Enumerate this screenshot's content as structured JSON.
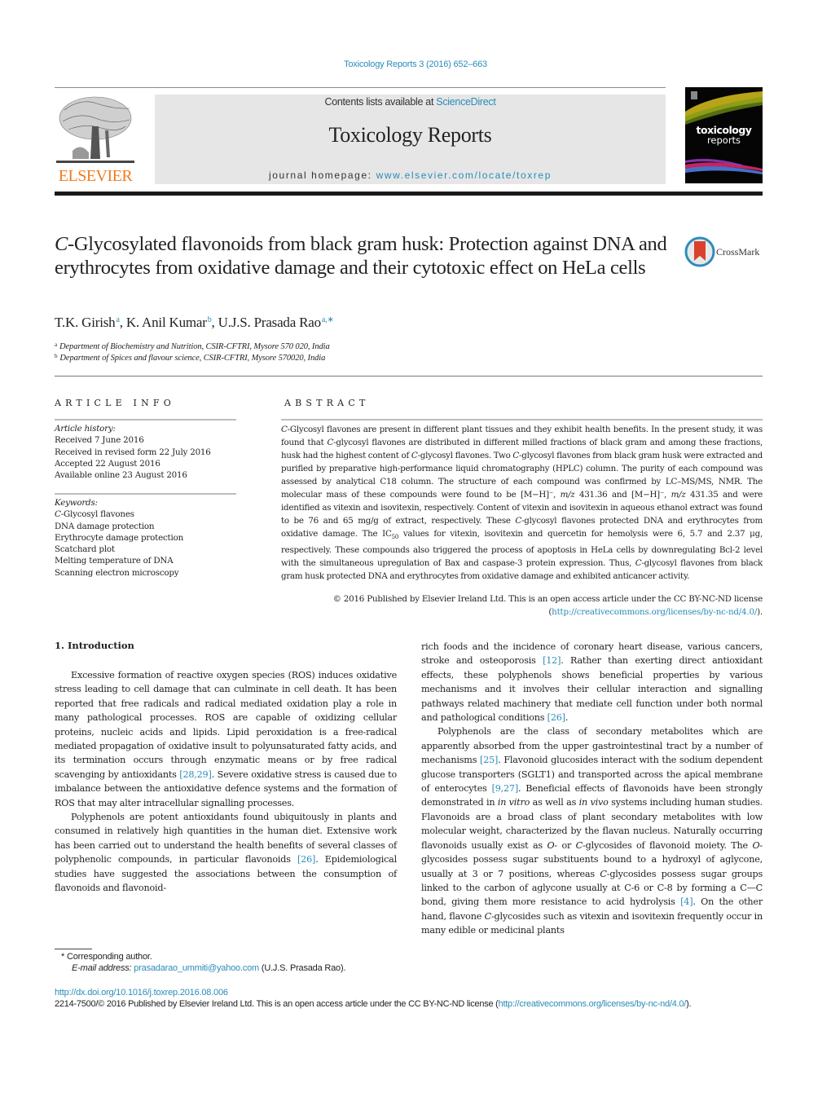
{
  "journal_ref": "Toxicology Reports 3 (2016) 652–663",
  "masthead": {
    "publisher_logo_text": "ELSEVIER",
    "contents_prefix": "Contents lists available at ",
    "contents_link": "ScienceDirect",
    "journal_title": "Toxicology Reports",
    "homepage_prefix": "journal homepage: ",
    "homepage_link": "www.elsevier.com/locate/toxrep",
    "cover_title": "toxicology",
    "cover_subtitle": "reports"
  },
  "colors": {
    "link": "#2a8cb8",
    "elsevier_orange": "#f07b1f",
    "masthead_bg": "#e6e6e6"
  },
  "article": {
    "title_italic_prefix": "C",
    "title_rest": "-Glycosylated flavonoids from black gram husk: Protection against DNA and erythrocytes from oxidative damage and their cytotoxic effect on HeLa cells",
    "crossmark_label": "CrossMark",
    "authors": [
      {
        "name": "T.K. Girish",
        "sup": "a"
      },
      {
        "name": "K. Anil Kumar",
        "sup": "b"
      },
      {
        "name": "U.J.S. Prasada Rao",
        "sup": "a,∗"
      }
    ],
    "affiliations": [
      {
        "mark": "a",
        "text": "Department of Biochemistry and Nutrition, CSIR-CFTRI, Mysore 570 020, India"
      },
      {
        "mark": "b",
        "text": "Department of Spices and flavour science, CSIR-CFTRI, Mysore 570020, India"
      }
    ]
  },
  "article_info": {
    "heading": "ARTICLE INFO",
    "history_label": "Article history:",
    "history": [
      "Received 7 June 2016",
      "Received in revised form 22 July 2016",
      "Accepted 22 August 2016",
      "Available online 23 August 2016"
    ],
    "keywords_label": "Keywords:",
    "keywords": [
      {
        "italic": "C",
        "rest": "-Glycosyl flavones"
      },
      {
        "italic": "",
        "rest": "DNA damage protection"
      },
      {
        "italic": "",
        "rest": "Erythrocyte damage protection"
      },
      {
        "italic": "",
        "rest": "Scatchard plot"
      },
      {
        "italic": "",
        "rest": "Melting temperature of DNA"
      },
      {
        "italic": "",
        "rest": "Scanning electron microscopy"
      }
    ]
  },
  "abstract": {
    "heading": "ABSTRACT",
    "s1_i": "C",
    "s1": "-Glycosyl flavones are present in different plant tissues and they exhibit health benefits. In the present study, it was found that ",
    "s2_i": "C",
    "s2": "-glycosyl flavones are distributed in different milled fractions of black gram and among these fractions, husk had the highest content of ",
    "s3_i": "C",
    "s3": "-glycosyl flavones. Two ",
    "s4_i": "C",
    "s4": "-glycosyl flavones from black gram husk were extracted and purified by preparative high-performance liquid chromatography (HPLC) column. The purity of each compound was assessed by analytical C18 column. The structure of each compound was confirmed by LC–MS/MS, NMR. The molecular mass of these compounds were found to be [M−H]⁻, ",
    "mz1_i": "m/z",
    "s5": " 431.36 and [M−H]⁻, ",
    "mz2_i": "m/z",
    "s6": " 431.35 and were identified as vitexin and isovitexin, respectively. Content of vitexin and isovitexin in aqueous ethanol extract was found to be 76 and 65 mg/g of extract, respectively. These ",
    "s7_i": "C",
    "s7": "-glycosyl flavones protected DNA and erythrocytes from oxidative damage. The IC",
    "ic_sub": "50",
    "s8": " values for vitexin, isovitexin and quercetin for hemolysis were 6, 5.7 and 2.37 μg, respectively. These compounds also triggered the process of apoptosis in HeLa cells by downregulating Bcl-2 level with the simultaneous upregulation of Bax and caspase-3 protein expression. Thus, ",
    "s9_i": "C",
    "s9": "-glycosyl flavones from black gram husk protected DNA and erythrocytes from oxidative damage and exhibited anticancer activity.",
    "copyright_prefix": "© 2016 Published by Elsevier Ireland Ltd. This is an open access article under the CC BY-NC-ND license (",
    "copyright_link": "http://creativecommons.org/licenses/by-nc-nd/4.0/",
    "copyright_suffix": ")."
  },
  "body": {
    "section_heading": "1.  Introduction",
    "left_p1_a": "Excessive formation of reactive oxygen species (ROS) induces oxidative stress leading to cell damage that can culminate in cell death. It has been reported that free radicals and radical mediated oxidation play a role in many pathological processes. ROS are capable of oxidizing cellular proteins, nucleic acids and lipids. Lipid peroxidation is a free-radical mediated propagation of oxidative insult to polyunsaturated fatty acids, and its termination occurs through enzymatic means or by free radical scavenging by antioxidants ",
    "left_p1_ref": "[28,29]",
    "left_p1_b": ". Severe oxidative stress is caused due to imbalance between the antioxidative defence systems and the formation of ROS that may alter intracellular signalling processes.",
    "left_p2_a": "Polyphenols are potent antioxidants found ubiquitously in plants and consumed in relatively high quantities in the human diet. Extensive work has been carried out to understand the health benefits of several classes of polyphenolic compounds, in particular flavonoids ",
    "left_p2_ref": "[26]",
    "left_p2_b": ". Epidemiological studies have suggested the associations between the consumption of flavonoids and flavonoid-",
    "right_p1_a": "rich foods and the incidence of coronary heart disease, various cancers, stroke and osteoporosis ",
    "right_p1_ref1": "[12]",
    "right_p1_b": ". Rather than exerting direct antioxidant effects, these polyphenols shows beneficial properties by various mechanisms and it involves their cellular interaction and signalling pathways related machinery that mediate cell function under both normal and pathological conditions ",
    "right_p1_ref2": "[26]",
    "right_p1_c": ".",
    "right_p2_a": "Polyphenols are the class of secondary metabolites which are apparently absorbed from the upper gastrointestinal tract by a number of mechanisms ",
    "right_p2_ref1": "[25]",
    "right_p2_b": ". Flavonoid glucosides interact with the sodium dependent glucose transporters (SGLT1) and transported across the apical membrane of enterocytes ",
    "right_p2_ref2": "[9,27]",
    "right_p2_c": ". Beneficial effects of flavonoids have been strongly demonstrated in ",
    "right_p2_i1": "in vitro",
    "right_p2_d": " as well as ",
    "right_p2_i2": "in vivo",
    "right_p2_e": " systems including human studies. Flavonoids are a broad class of plant secondary metabolites with low molecular weight, characterized by the flavan nucleus. Naturally occurring flavonoids usually exist as ",
    "right_p2_i3": "O",
    "right_p2_f": "- or ",
    "right_p2_i4": "C",
    "right_p2_g": "-glycosides of flavonoid moiety. The ",
    "right_p2_i5": "O",
    "right_p2_h": "-glycosides possess sugar substituents bound to a hydroxyl of aglycone, usually at 3 or 7 positions, whereas ",
    "right_p2_i6": "C",
    "right_p2_j": "-glycosides possess sugar groups linked to the carbon of aglycone usually at C-6 or C-8 by forming a C—C bond, giving them more resistance to acid hydrolysis ",
    "right_p2_ref3": "[4]",
    "right_p2_k": ". On the other hand, flavone ",
    "right_p2_i7": "C",
    "right_p2_l": "-glycosides such as vitexin and isovitexin frequently occur in many edible or medicinal plants"
  },
  "footnotes": {
    "corresponding_mark": "*",
    "corresponding": " Corresponding author.",
    "email_label": "E-mail address: ",
    "email_link": "prasadarao_ummiti@yahoo.com",
    "email_suffix": " (U.J.S. Prasada Rao)."
  },
  "footer": {
    "doi_link": "http://dx.doi.org/10.1016/j.toxrep.2016.08.006",
    "license_prefix": "2214-7500/© 2016 Published by Elsevier Ireland Ltd. This is an open access article under the CC BY-NC-ND license (",
    "license_link": "http://creativecommons.org/licenses/by-nc-nd/4.0/",
    "license_suffix": ")."
  }
}
